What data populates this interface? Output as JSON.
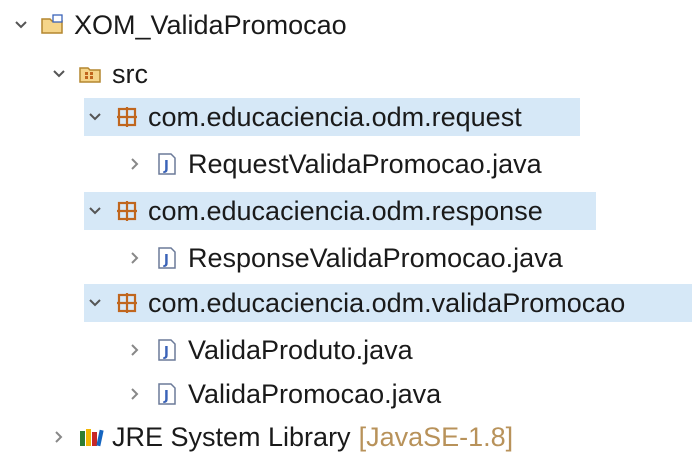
{
  "tree": {
    "project": {
      "label": "XOM_ValidaPromocao",
      "icon": "project-folder-icon"
    },
    "src": {
      "label": "src",
      "icon": "source-folder-icon"
    },
    "packages": [
      {
        "label": "com.educaciencia.odm.request",
        "icon": "package-icon",
        "files": [
          {
            "label": "RequestValidaPromocao.java",
            "icon": "java-file-icon"
          }
        ]
      },
      {
        "label": "com.educaciencia.odm.response",
        "icon": "package-icon",
        "files": [
          {
            "label": "ResponseValidaPromocao.java",
            "icon": "java-file-icon"
          }
        ]
      },
      {
        "label": "com.educaciencia.odm.validaPromocao",
        "icon": "package-icon",
        "files": [
          {
            "label": "ValidaProduto.java",
            "icon": "java-file-icon"
          },
          {
            "label": "ValidaPromocao.java",
            "icon": "java-file-icon"
          }
        ]
      }
    ],
    "library": {
      "label": "JRE System Library",
      "decoration": "[JavaSE-1.8]",
      "icon": "library-icon"
    }
  },
  "colors": {
    "selection": "#d6e8f7",
    "package_icon": "#c0661e",
    "java_icon": "#3b63b8",
    "decoration": "#b8925a",
    "twistie": "#555555"
  }
}
